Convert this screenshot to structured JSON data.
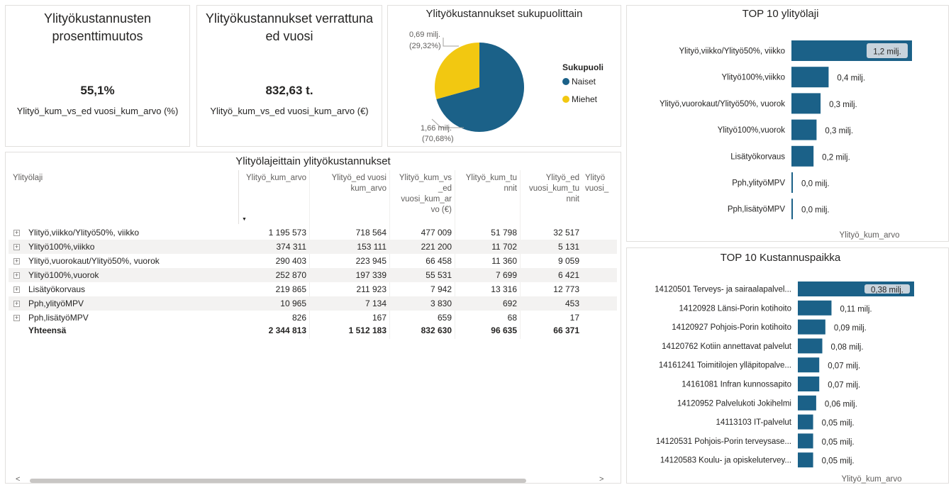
{
  "kpi_percent": {
    "title": "Ylityökustannusten prosenttimuutos",
    "value": "55,1%",
    "label": "Ylityö_kum_vs_ed vuosi_kum_arvo (%)"
  },
  "kpi_vs_prev": {
    "title": "Ylityökustannukset verrattuna ed vuosi",
    "value": "832,63 t.",
    "label": "Ylityö_kum_vs_ed vuosi_kum_arvo (€)"
  },
  "pie": {
    "title": "Ylityökustannukset sukupuolittain",
    "legend_title": "Sukupuoli",
    "colors": {
      "naiset": "#1B6188",
      "miehet": "#F2C811"
    },
    "chart_data": {
      "type": "pie",
      "slices": [
        {
          "name": "Naiset",
          "value": 1.66,
          "percent": 70.68,
          "label_value": "1,66 milj.",
          "label_percent": "(70,68%)"
        },
        {
          "name": "Miehet",
          "value": 0.69,
          "percent": 29.32,
          "label_value": "0,69 milj.",
          "label_percent": "(29,32%)"
        }
      ]
    }
  },
  "top_ylityolaji": {
    "title": "TOP 10 ylityölaji",
    "axis_label": "Ylityö_kum_arvo",
    "bar_color": "#1B6188",
    "chart_data": {
      "type": "bar",
      "orientation": "horizontal",
      "categories": [
        "Ylityö,viikko/Ylityö50%, viikko",
        "Ylityö100%,viikko",
        "Ylityö,vuorokaut/Ylityö50%, vuorok",
        "Ylityö100%,vuorok",
        "Lisätyökorvaus",
        "Pph,ylityöMPV",
        "Pph,lisätyöMPV"
      ],
      "values": [
        1.2,
        0.37,
        0.29,
        0.25,
        0.22,
        0.011,
        0.001
      ],
      "labels": [
        "1,2 milj.",
        "0,4 milj.",
        "0,3 milj.",
        "0,3 milj.",
        "0,2 milj.",
        "0,0 milj.",
        "0,0 milj."
      ],
      "xlim": [
        0,
        1.2
      ]
    }
  },
  "top_kustannuspaikka": {
    "title": "TOP 10 Kustannuspaikka",
    "axis_label": "Ylityö_kum_arvo",
    "bar_color": "#1B6188",
    "chart_data": {
      "type": "bar",
      "orientation": "horizontal",
      "categories": [
        "14120501 Terveys- ja sairaalapalvel...",
        "14120928 Länsi-Porin kotihoito",
        "14120927 Pohjois-Porin kotihoito",
        "14120762 Kotiin annettavat palvelut",
        "14161241 Toimitilojen ylläpitopalve...",
        "14161081 Infran kunnossapito",
        "14120952 Palvelukoti Jokihelmi",
        "14113103 IT-palvelut",
        "14120531 Pohjois-Porin terveysase...",
        "14120583 Koulu- ja opiskelutervey..."
      ],
      "values": [
        0.38,
        0.11,
        0.09,
        0.08,
        0.07,
        0.07,
        0.06,
        0.05,
        0.05,
        0.05
      ],
      "labels": [
        "0,38 milj.",
        "0,11 milj.",
        "0,09 milj.",
        "0,08 milj.",
        "0,07 milj.",
        "0,07 milj.",
        "0,06 milj.",
        "0,05 milj.",
        "0,05 milj.",
        "0,05 milj."
      ],
      "xlim": [
        0,
        0.38
      ]
    }
  },
  "table": {
    "title": "Ylityölajeittain ylityökustannukset",
    "row_header": "Ylityölaji",
    "columns": [
      [
        "Ylityö_kum_arvo"
      ],
      [
        "Ylityö_ed vuosi",
        "kum_arvo"
      ],
      [
        "Ylityö_kum_vs",
        "_ed",
        "vuosi_kum_ar",
        "vo (€)"
      ],
      [
        "Ylityö_kum_tu",
        "nnit"
      ],
      [
        "Ylityö_ed",
        "vuosi_kum_tu",
        "nnit"
      ],
      [
        "Ylityö",
        "vuosi_"
      ]
    ],
    "rows": [
      {
        "label": "Ylityö,viikko/Ylityö50%, viikko",
        "values": [
          "1 195 573",
          "718 564",
          "477 009",
          "51 798",
          "32 517"
        ]
      },
      {
        "label": "Ylityö100%,viikko",
        "values": [
          "374 311",
          "153 111",
          "221 200",
          "11 702",
          "5 131"
        ]
      },
      {
        "label": "Ylityö,vuorokaut/Ylityö50%, vuorok",
        "values": [
          "290 403",
          "223 945",
          "66 458",
          "11 360",
          "9 059"
        ]
      },
      {
        "label": "Ylityö100%,vuorok",
        "values": [
          "252 870",
          "197 339",
          "55 531",
          "7 699",
          "6 421"
        ]
      },
      {
        "label": "Lisätyökorvaus",
        "values": [
          "219 865",
          "211 923",
          "7 942",
          "13 316",
          "12 773"
        ]
      },
      {
        "label": "Pph,ylityöMPV",
        "values": [
          "10 965",
          "7 134",
          "3 830",
          "692",
          "453"
        ]
      },
      {
        "label": "Pph,lisätyöMPV",
        "values": [
          "826",
          "167",
          "659",
          "68",
          "17"
        ]
      }
    ],
    "total": {
      "label": "Yhteensä",
      "values": [
        "2 344 813",
        "1 512 183",
        "832 630",
        "96 635",
        "66 371"
      ]
    },
    "expand_icon": "+",
    "sort_icon": "▼",
    "scroll_left": "<",
    "scroll_right": ">"
  }
}
